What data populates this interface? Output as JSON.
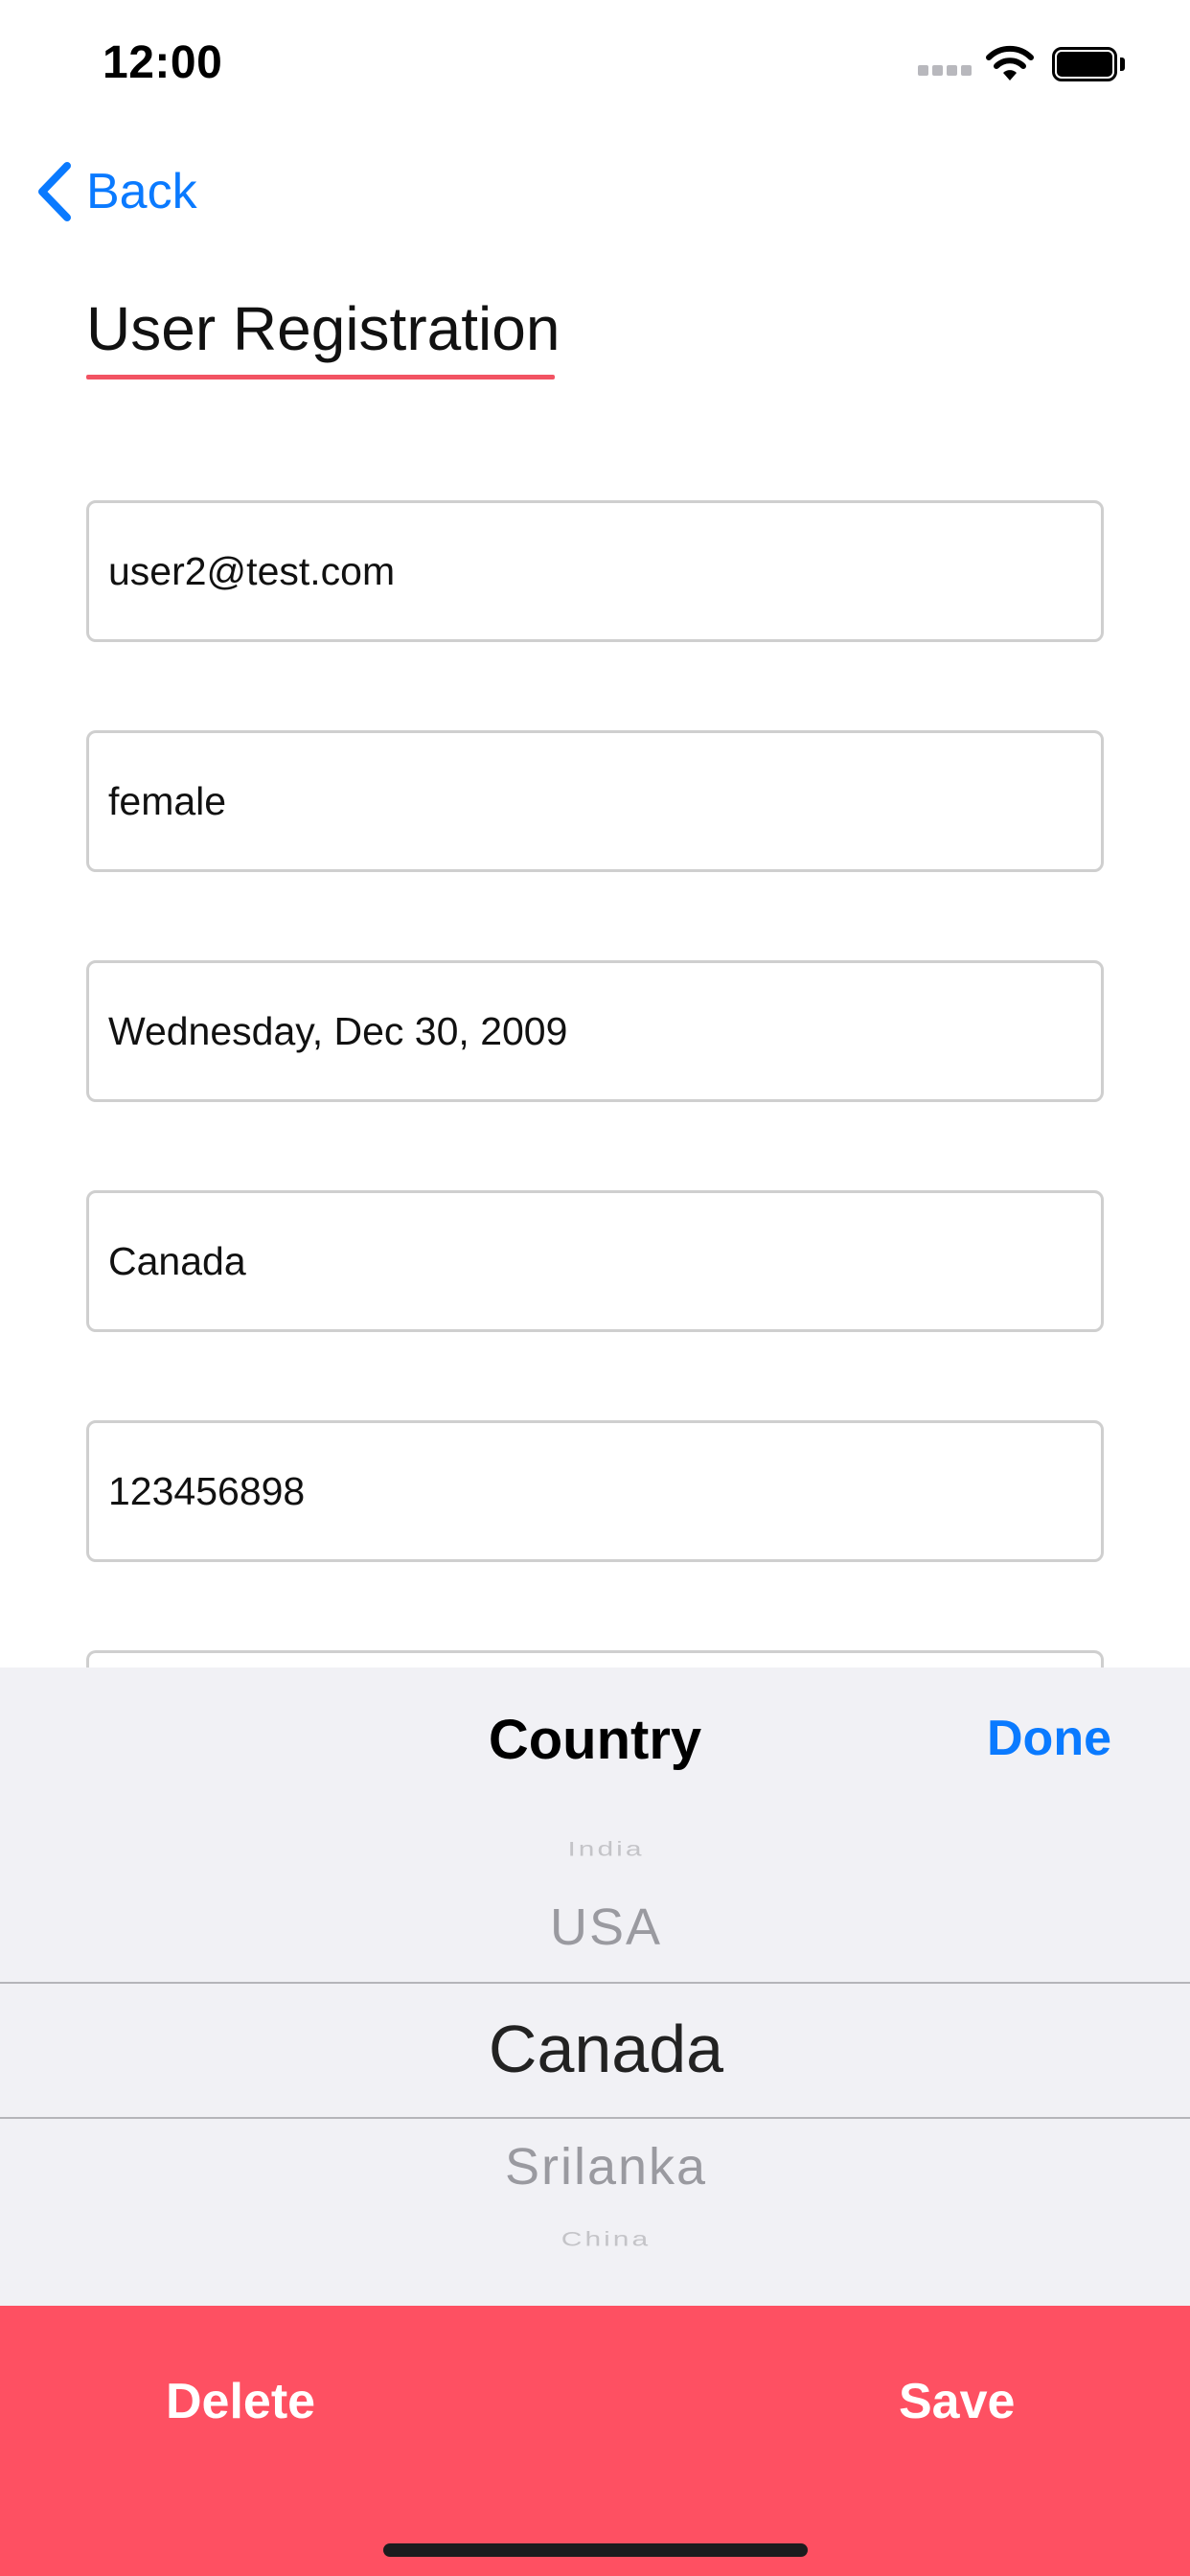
{
  "status_bar": {
    "time": "12:00",
    "icons": [
      "signal-icon",
      "wifi-icon",
      "battery-icon"
    ]
  },
  "nav": {
    "back_label": "Back",
    "back_icon": "chevron-left-icon"
  },
  "page": {
    "title": "User Registration"
  },
  "form": {
    "email": "user2@test.com",
    "gender": "female",
    "date_of_birth": "Wednesday, Dec 30, 2009",
    "country": "Canada",
    "phone": "123456898"
  },
  "picker": {
    "title": "Country",
    "done_label": "Done",
    "options": [
      "India",
      "USA",
      "Canada",
      "Srilanka",
      "China"
    ],
    "selected": "Canada"
  },
  "actions": {
    "delete_label": "Delete",
    "save_label": "Save"
  },
  "colors": {
    "accent_blue": "#0a7aff",
    "brand_red": "#fe5062",
    "underline_red": "#f25363",
    "picker_bg": "#f1f1f5"
  }
}
